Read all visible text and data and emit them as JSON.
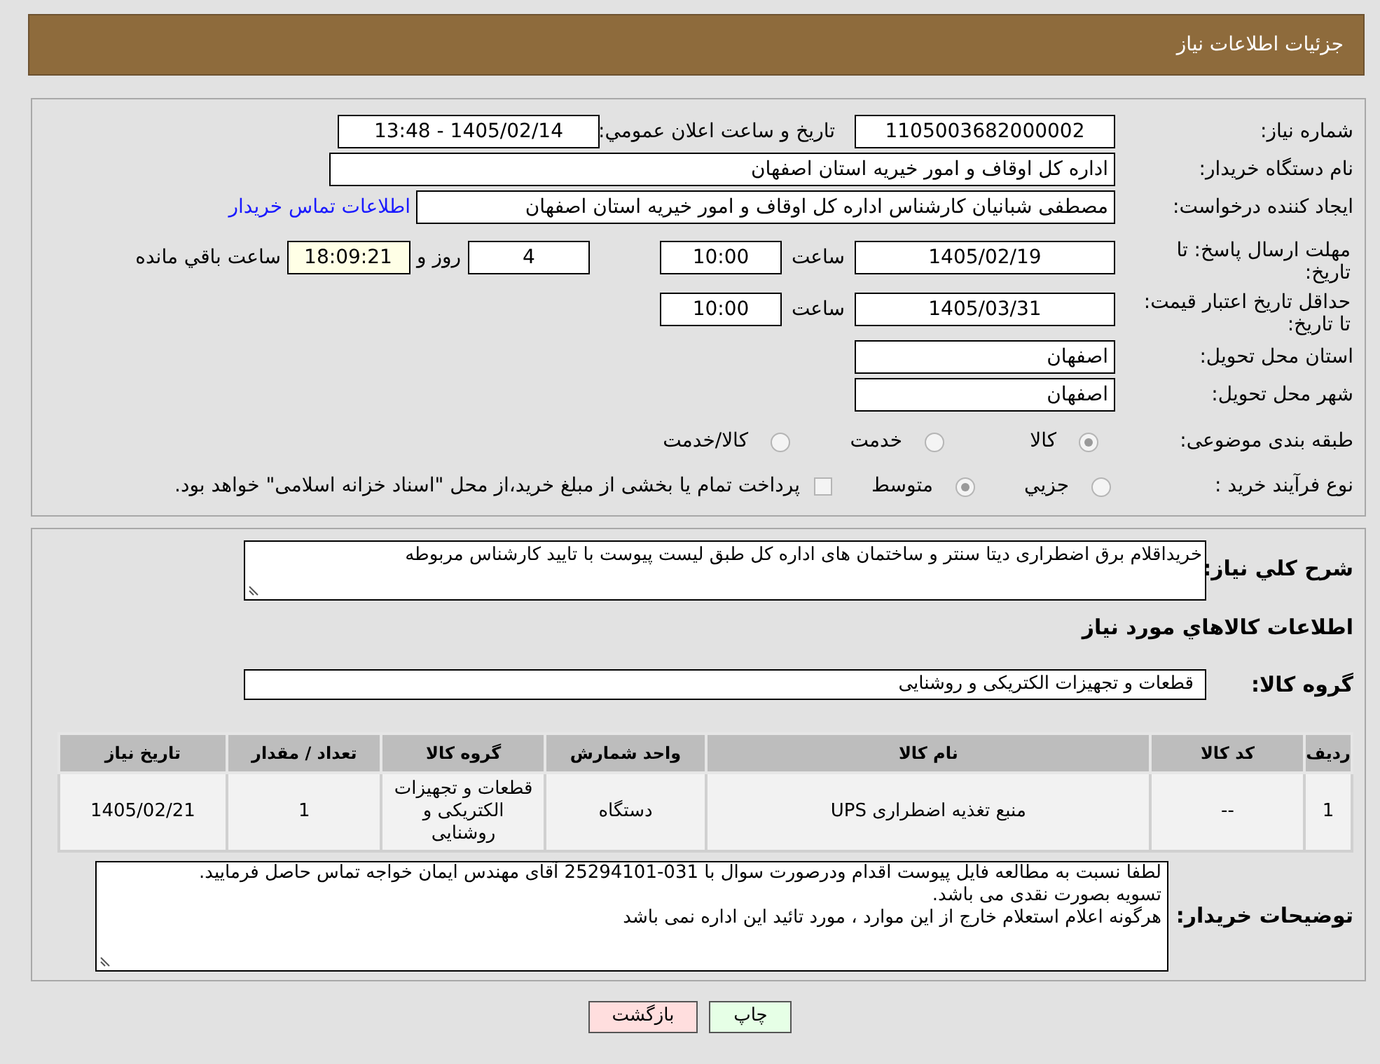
{
  "header": {
    "title": "جزئیات اطلاعات نیاز"
  },
  "need_number": {
    "label": "شماره نیاز:",
    "value": "1105003682000002"
  },
  "announce": {
    "label": "تاریخ و ساعت اعلان عمومي:",
    "value": "1405/02/14 - 13:48"
  },
  "buyer_org": {
    "label": "نام دستگاه خريدار:",
    "value": "اداره کل اوقاف و امور خیریه استان اصفهان"
  },
  "requester": {
    "label": "ایجاد کننده درخواست:",
    "value": "مصطفی شبانیان کارشناس اداره کل اوقاف و امور خیریه استان اصفهان",
    "link": "اطلاعات تماس خریدار"
  },
  "reply_deadline": {
    "label": "مهلت ارسال پاسخ: تا تاریخ:",
    "date": "1405/02/19",
    "time_label": "ساعت",
    "time": "10:00",
    "days": "4",
    "days_label": "روز و",
    "remaining": "18:09:21",
    "remaining_label": "ساعت باقي مانده"
  },
  "price_validity": {
    "label": "حداقل تاریخ اعتبار قیمت: تا تاریخ:",
    "date": "1405/03/31",
    "time_label": "ساعت",
    "time": "10:00"
  },
  "delivery_province": {
    "label": "استان محل تحویل:",
    "value": "اصفهان"
  },
  "delivery_city": {
    "label": "شهر محل تحویل:",
    "value": "اصفهان"
  },
  "category": {
    "label": "طبقه بندی موضوعی:",
    "options": [
      {
        "label": "کالا",
        "selected": true
      },
      {
        "label": "خدمت",
        "selected": false
      },
      {
        "label": "کالا/خدمت",
        "selected": false
      }
    ]
  },
  "purchase_type": {
    "label": "نوع فرآیند خرید :",
    "options": [
      {
        "label": "جزيي",
        "selected": false
      },
      {
        "label": "متوسط",
        "selected": true
      }
    ],
    "payment": {
      "checked": false,
      "text": "پرداخت تمام يا بخشی از مبلغ خرید،از محل \"اسناد خزانه اسلامی\" خواهد بود."
    }
  },
  "description": {
    "label": "شرح کلي نیاز:",
    "value": "خریداقلام برق اضطراری دیتا سنتر و ساختمان های اداره کل طبق لیست پیوست با تایید کارشناس مربوطه"
  },
  "goods_heading": "اطلاعات کالاهاي مورد نیاز",
  "goods_group": {
    "label": "گروه کالا:",
    "value": "قطعات و تجهیزات الکتریکی و روشنایی"
  },
  "table": {
    "columns": [
      "ردیف",
      "کد کالا",
      "نام کالا",
      "واحد شمارش",
      "گروه کالا",
      "تعداد / مقدار",
      "تاریخ نیاز"
    ],
    "rows": [
      [
        "1",
        "--",
        "منبع تغذیه اضطراری UPS",
        "دستگاه",
        "قطعات و تجهیزات الکتریکی و روشنایی",
        "1",
        "1405/02/21"
      ]
    ]
  },
  "buyer_notes": {
    "label": "توضیحات خریدار:",
    "lines": [
      "لطفا نسبت به مطالعه فایل پیوست اقدام ودرصورت سوال با  031-25294101 آقای مهندس ایمان خواجه  تماس حاصل فرمایید.",
      "تسویه بصورت نقدی می باشد.",
      "هرگونه اعلام استعلام خارج از این موارد ، مورد تائید این اداره نمی باشد"
    ]
  },
  "buttons": [
    {
      "label": "چاپ",
      "kind": "print"
    },
    {
      "label": "بازگشت",
      "kind": "back"
    }
  ]
}
